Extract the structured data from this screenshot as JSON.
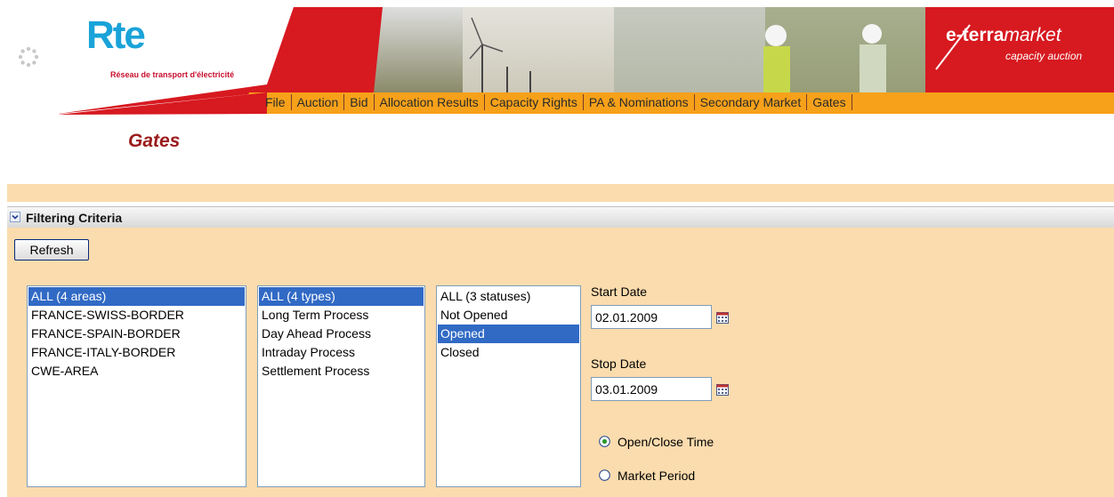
{
  "header": {
    "logo_text": "Rte",
    "logo_subtitle": "Réseau de transport d'électricité",
    "brand_prefix": "e-terra",
    "brand_suffix": "market",
    "brand_subtitle": "capacity auction"
  },
  "menu": {
    "items": [
      "File",
      "Auction",
      "Bid",
      "Allocation Results",
      "Capacity Rights",
      "PA & Nominations",
      "Secondary Market",
      "Gates"
    ]
  },
  "page": {
    "title": "Gates"
  },
  "filter": {
    "title": "Filtering Criteria",
    "refresh_label": "Refresh",
    "areas": {
      "options": [
        "ALL (4 areas)",
        "FRANCE-SWISS-BORDER",
        "FRANCE-SPAIN-BORDER",
        "FRANCE-ITALY-BORDER",
        "CWE-AREA"
      ],
      "selected": "ALL (4 areas)"
    },
    "types": {
      "options": [
        "ALL (4 types)",
        "Long Term Process",
        "Day Ahead Process",
        "Intraday Process",
        "Settlement Process"
      ],
      "selected": "ALL (4 types)"
    },
    "statuses": {
      "options": [
        "ALL (3 statuses)",
        "Not Opened",
        "Opened",
        "Closed"
      ],
      "selected": "Opened"
    },
    "start_date_label": "Start Date",
    "start_date_value": "02.01.2009",
    "stop_date_label": "Stop Date",
    "stop_date_value": "03.01.2009",
    "radio_open_close_label": "Open/Close Time",
    "radio_market_period_label": "Market Period",
    "radio_selected": "Open/Close Time"
  },
  "colors": {
    "panel_bg": "#fbdcae",
    "menu_bar": "#f7a11a",
    "banner_red": "#d71920",
    "title_red": "#9b1b1b",
    "selection_blue": "#316ac5",
    "logo_blue": "#1aa3d9"
  }
}
